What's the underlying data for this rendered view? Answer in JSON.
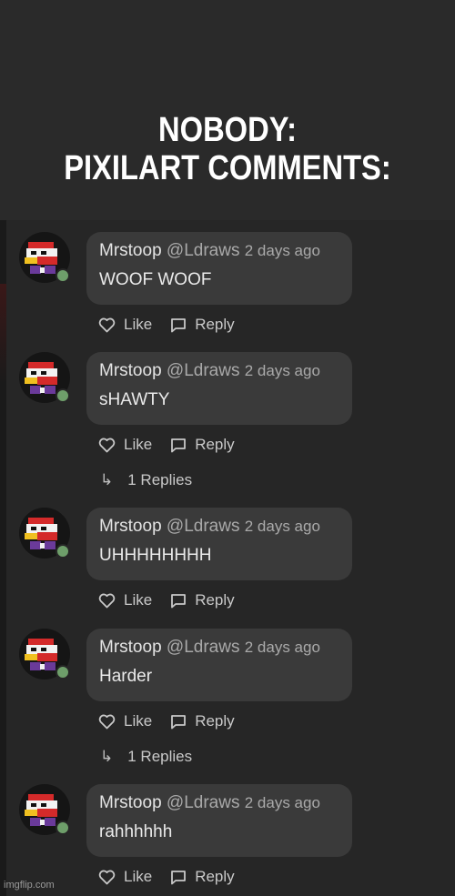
{
  "caption": {
    "line1": "NOBODY:",
    "line2": "PIXILART COMMENTS:"
  },
  "actions": {
    "like_label": "Like",
    "reply_label": "Reply"
  },
  "comments": [
    {
      "author": "Mrstoop",
      "mention": "@Ldraws",
      "time": "2 days ago",
      "text": "WOOF WOOF",
      "replies": ""
    },
    {
      "author": "Mrstoop",
      "mention": "@Ldraws",
      "time": "2 days ago",
      "text": "sHAWTY",
      "replies": "1 Replies"
    },
    {
      "author": "Mrstoop",
      "mention": "@Ldraws",
      "time": "2 days ago",
      "text": "UHHHHHHHH",
      "replies": ""
    },
    {
      "author": "Mrstoop",
      "mention": "@Ldraws",
      "time": "2 days ago",
      "text": "Harder",
      "replies": "1 Replies"
    },
    {
      "author": "Mrstoop",
      "mention": "@Ldraws",
      "time": "2 days ago",
      "text": "rahhhhhh",
      "replies": ""
    }
  ],
  "watermark": "imgflip.com",
  "colors": {
    "background": "#2a2a2a",
    "bubble": "#3a3a3a",
    "online_dot": "#6e9e6a",
    "avatar_red": "#d42a2a",
    "avatar_purple": "#6a3a9a",
    "avatar_yellow": "#f0c020"
  }
}
